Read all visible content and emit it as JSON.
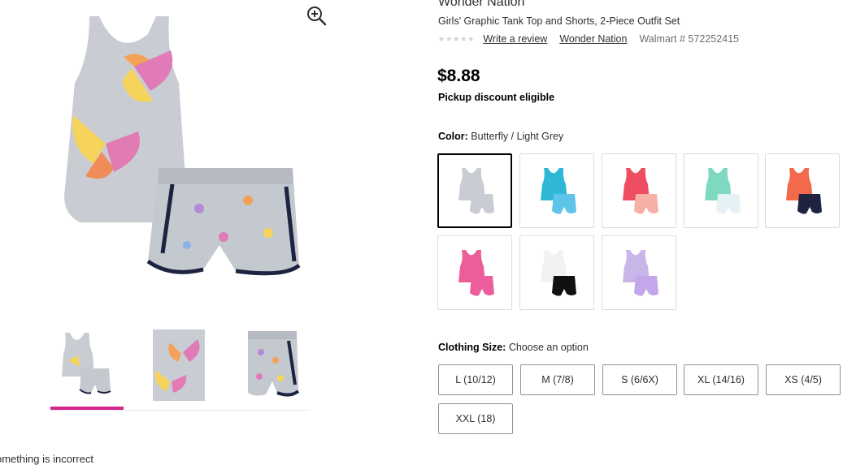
{
  "product": {
    "brand": "Wonder Nation",
    "title": "Girls' Graphic Tank Top and Shorts, 2-Piece Outfit Set",
    "rating_stars": "★★★★★",
    "write_review": "Write a review",
    "brand_link": "Wonder Nation",
    "walmart_number": "Walmart # 572252415",
    "price": "$8.88",
    "pickup": "Pickup discount eligible"
  },
  "color": {
    "label": "Color:",
    "selected": "Butterfly / Light Grey",
    "swatch_colors": [
      "#c9cdd3",
      "#2fb8d6",
      "#ee4d62",
      "#7fd9c0",
      "#f26a4b",
      "#ec5e9a",
      "#f2f2f2",
      "#c9b6e8"
    ],
    "short_colors": [
      "#c9cdd3",
      "#5fc4ea",
      "#f7b0a8",
      "#e6f1f6",
      "#1d2340",
      "#ee5e9c",
      "#111111",
      "#c4a6ea"
    ]
  },
  "size": {
    "label": "Clothing Size:",
    "selected": "Choose an option",
    "options": [
      "L (10/12)",
      "M (7/8)",
      "S (6/6X)",
      "XL (14/16)",
      "XS (4/5)",
      "XXL (18)"
    ]
  },
  "feedback": "omething is incorrect",
  "icons": {
    "zoom": "zoom-in-icon"
  }
}
